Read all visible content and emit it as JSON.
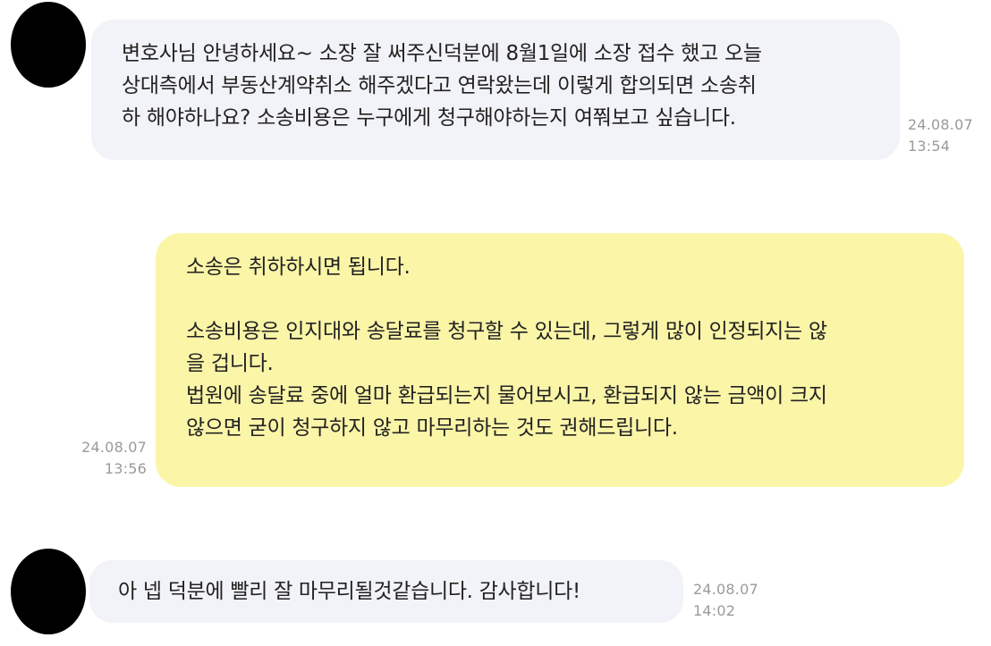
{
  "messages": [
    {
      "sender": "client",
      "lines": [
        "변호사님 안녕하세요~ 소장 잘 써주신덕분에 8월1일에 소장 접수 했고 오늘",
        "상대측에서 부동산계약취소 해주겠다고 연락왔는데 이렇게 합의되면 소송취",
        "하 해야하나요? 소송비용은 누구에게 청구해야하는지 여쭤보고 싶습니다."
      ],
      "date": "24.08.07",
      "time": "13:54"
    },
    {
      "sender": "lawyer",
      "lines": [
        "소송은 취하하시면 됩니다.",
        "",
        "소송비용은 인지대와 송달료를 청구할 수 있는데, 그렇게 많이 인정되지는 않",
        "을 겁니다.",
        "법원에 송달료 중에 얼마 환급되는지 물어보시고, 환급되지 않는 금액이 크지",
        "않으면 굳이 청구하지 않고 마무리하는 것도 권해드립니다."
      ],
      "date": "24.08.07",
      "time": "13:56"
    },
    {
      "sender": "client",
      "lines": [
        "아 넵 덕분에 빨리 잘 마무리될것같습니다. 감사합니다!"
      ],
      "date": "24.08.07",
      "time": "14:02"
    }
  ],
  "colors": {
    "incoming_bubble": "#f2f3f8",
    "outgoing_bubble": "#fbf5a8",
    "timestamp": "#9a9a9a",
    "text": "#222222",
    "avatar": "#000000"
  }
}
